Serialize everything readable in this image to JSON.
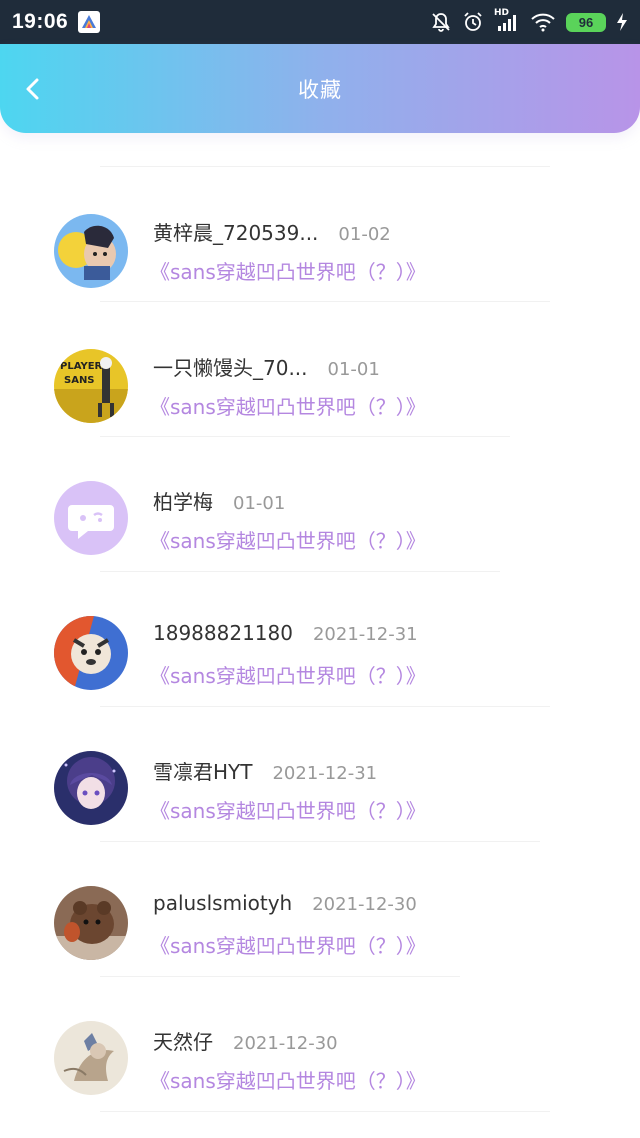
{
  "status_bar": {
    "time": "19:06",
    "network": "HD",
    "battery": "96"
  },
  "header": {
    "title": "收藏",
    "back_icon": "chevron-left-icon"
  },
  "favorites": [
    {
      "user": "黄梓晨_720539...",
      "date": "01-02",
      "title": "《sans穿越凹凸世界吧（？）》"
    },
    {
      "user": "一只懒馒头_70...",
      "date": "01-01",
      "title": "《sans穿越凹凸世界吧（？）》"
    },
    {
      "user": "柏学梅",
      "date": "01-01",
      "title": "《sans穿越凹凸世界吧（？）》"
    },
    {
      "user": "18988821180",
      "date": "2021-12-31",
      "title": "《sans穿越凹凸世界吧（？）》"
    },
    {
      "user": "雪凛君HYT",
      "date": "2021-12-31",
      "title": "《sans穿越凹凸世界吧（？）》"
    },
    {
      "user": "paluslsmiotyh",
      "date": "2021-12-30",
      "title": "《sans穿越凹凸世界吧（？）》"
    },
    {
      "user": "天然仔",
      "date": "2021-12-30",
      "title": "《sans穿越凹凸世界吧（？）》"
    }
  ],
  "colors": {
    "header_gradient_start": "#4dd6f0",
    "header_gradient_end": "#b894e8",
    "title_link": "#b487e0",
    "default_avatar": "#d9c2f7"
  }
}
